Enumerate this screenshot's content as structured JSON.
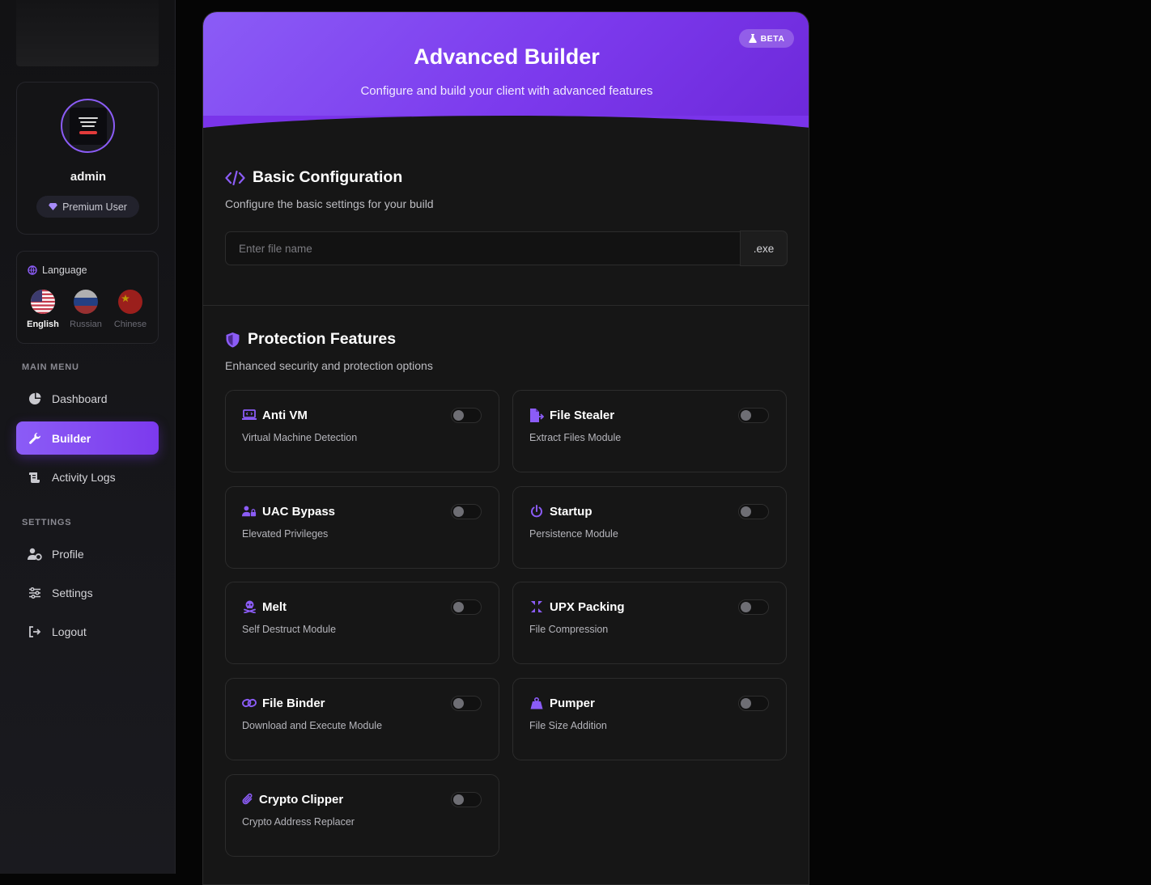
{
  "sidebar": {
    "user": {
      "name": "admin",
      "badge": "Premium User"
    },
    "language": {
      "title": "Language",
      "options": [
        {
          "label": "English",
          "active": true
        },
        {
          "label": "Russian",
          "active": false
        },
        {
          "label": "Chinese",
          "active": false
        }
      ]
    },
    "main_menu_label": "MAIN MENU",
    "main_menu": [
      {
        "label": "Dashboard",
        "icon": "chart-pie-icon",
        "active": false
      },
      {
        "label": "Builder",
        "icon": "wrench-icon",
        "active": true
      },
      {
        "label": "Activity Logs",
        "icon": "scroll-icon",
        "active": false
      }
    ],
    "settings_label": "SETTINGS",
    "settings_menu": [
      {
        "label": "Profile",
        "icon": "user-gear-icon"
      },
      {
        "label": "Settings",
        "icon": "sliders-icon"
      },
      {
        "label": "Logout",
        "icon": "logout-icon"
      }
    ]
  },
  "header": {
    "title": "Advanced Builder",
    "subtitle": "Configure and build your client with advanced features",
    "badge": "BETA"
  },
  "basic": {
    "title": "Basic Configuration",
    "subtitle": "Configure the basic settings for your build",
    "file_name_placeholder": "Enter file name",
    "file_name_value": "",
    "extension": ".exe"
  },
  "protection": {
    "title": "Protection Features",
    "subtitle": "Enhanced security and protection options",
    "features": [
      {
        "title": "Anti VM",
        "desc": "Virtual Machine Detection",
        "icon": "laptop-code-icon",
        "enabled": false
      },
      {
        "title": "File Stealer",
        "desc": "Extract Files Module",
        "icon": "file-export-icon",
        "enabled": false
      },
      {
        "title": "UAC Bypass",
        "desc": "Elevated Privileges",
        "icon": "user-lock-icon",
        "enabled": false
      },
      {
        "title": "Startup",
        "desc": "Persistence Module",
        "icon": "power-icon",
        "enabled": false
      },
      {
        "title": "Melt",
        "desc": "Self Destruct Module",
        "icon": "skull-crossbones-icon",
        "enabled": false
      },
      {
        "title": "UPX Packing",
        "desc": "File Compression",
        "icon": "compress-icon",
        "enabled": false
      },
      {
        "title": "File Binder",
        "desc": "Download and Execute Module",
        "icon": "link-icon",
        "enabled": false
      },
      {
        "title": "Pumper",
        "desc": "File Size Addition",
        "icon": "weight-icon",
        "enabled": false
      },
      {
        "title": "Crypto Clipper",
        "desc": "Crypto Address Replacer",
        "icon": "paperclip-icon",
        "enabled": false
      }
    ]
  },
  "colors": {
    "accent": "#8b5cf6",
    "accent_dark": "#6d28d9",
    "background": "#050505",
    "panel": "#161616"
  }
}
